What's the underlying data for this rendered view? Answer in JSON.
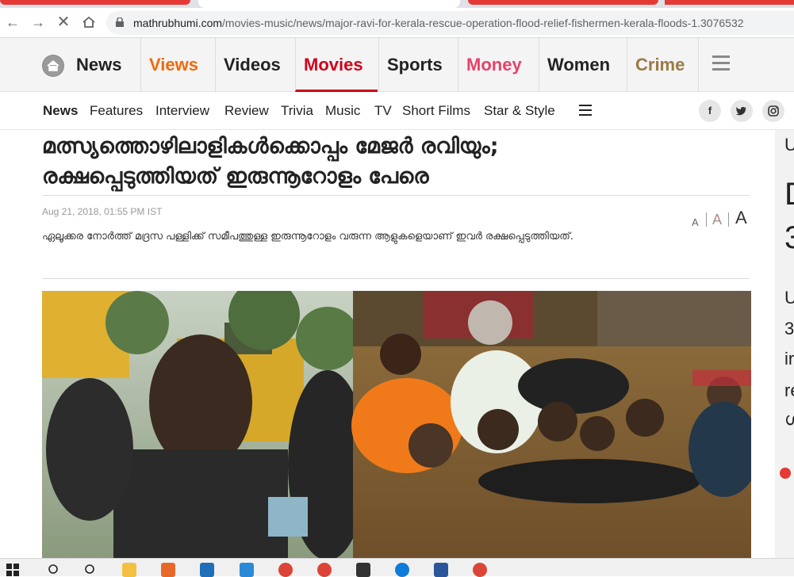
{
  "browser": {
    "url_domain": "mathrubhumi.com",
    "url_path": "/movies-music/news/major-ravi-for-kerala-rescue-operation-flood-relief-fishermen-kerala-floods-1.3076532"
  },
  "main_nav": {
    "items": [
      {
        "label": "News",
        "color": "#222222"
      },
      {
        "label": "Views",
        "color": "#f06a0c"
      },
      {
        "label": "Videos",
        "color": "#222222"
      },
      {
        "label": "Movies",
        "color": "#d0021b"
      },
      {
        "label": "Sports",
        "color": "#222222"
      },
      {
        "label": "Money",
        "color": "#e8416a"
      },
      {
        "label": "Women",
        "color": "#222222"
      },
      {
        "label": "Crime",
        "color": "#9b7a45"
      }
    ]
  },
  "sub_nav": {
    "items": [
      "News",
      "Features",
      "Interview",
      "Review",
      "Trivia",
      "Music",
      "TV",
      "Short Films",
      "Star & Style"
    ],
    "social": [
      "f",
      "t",
      "in"
    ]
  },
  "article": {
    "headline_line1": "മത്സ്യത്തൊഴിലാളികൾക്കൊപ്പം മേജർ രവിയും;",
    "headline_line2": "രക്ഷപ്പെടുത്തിയത് ഇരുന്നൂറോളം പേരെ",
    "date": "Aug 21, 2018, 01:55 PM IST",
    "summary": "ഏലൂക്കര നോർത്ത് മദ്രസ പള്ളിക്ക് സമീപത്തുള്ള ഇരുന്നൂറോളം വരുന്ന ആളുകളെയാണ് ഇവർ രക്ഷപ്പെടുത്തിയത്.",
    "font_sizes": [
      "A",
      "A",
      "A"
    ]
  },
  "sidebar_peek": {
    "lines": [
      "U",
      "D",
      "3",
      "U",
      "3",
      "ir",
      "re",
      "ഗ"
    ]
  }
}
